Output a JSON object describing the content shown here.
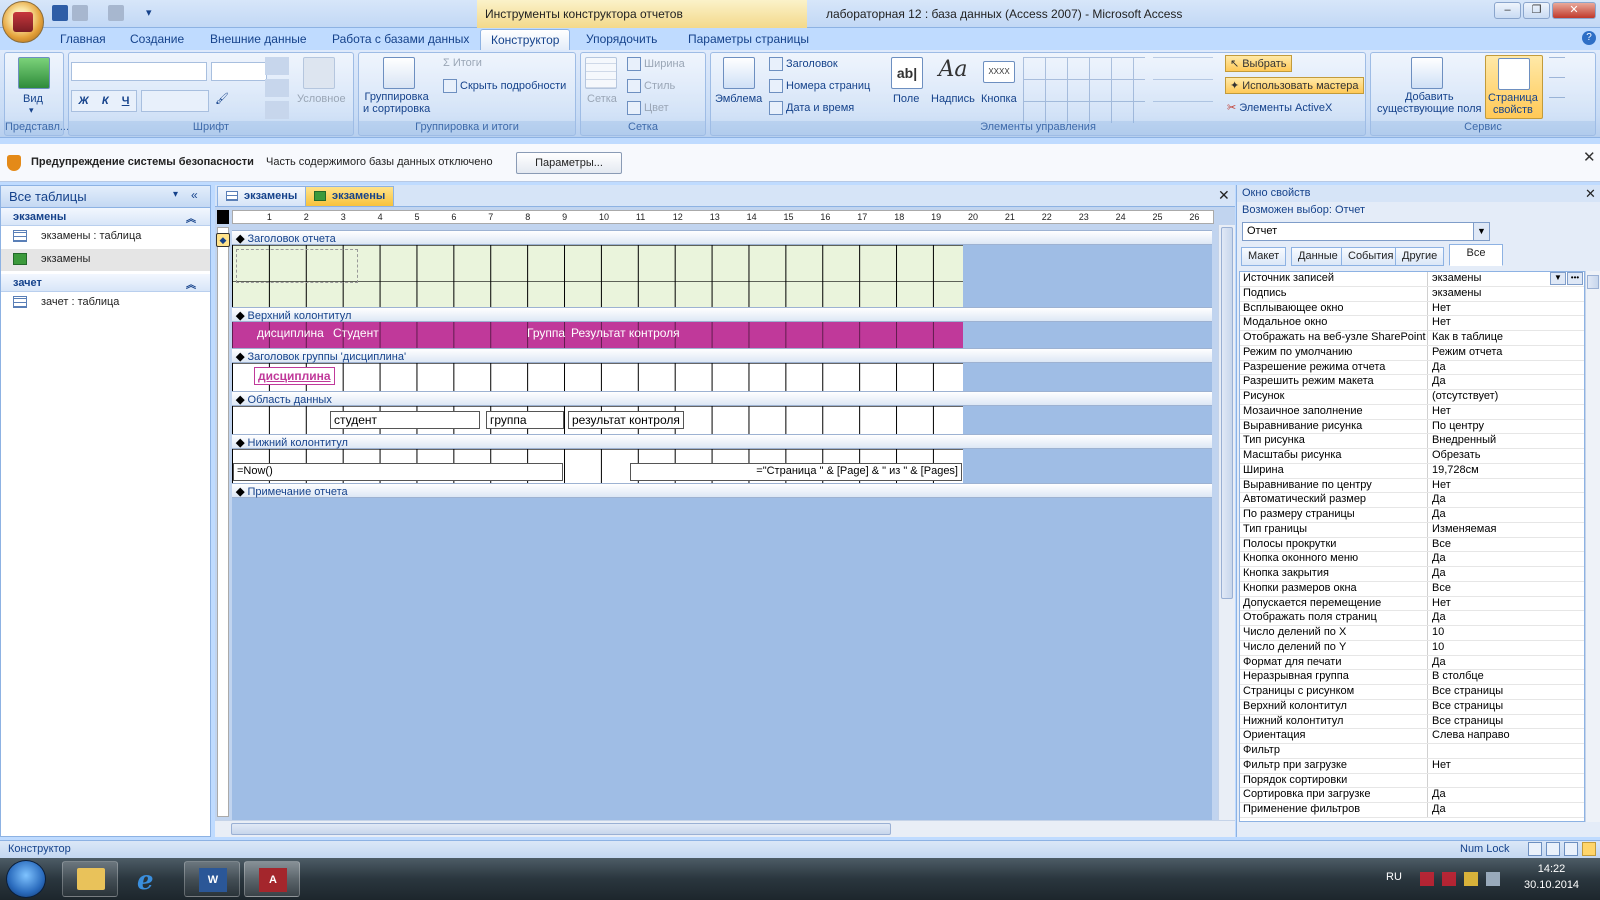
{
  "window": {
    "contextual_title": "Инструменты конструктора отчетов",
    "title": "лабораторная 12 : база данных (Access 2007) - Microsoft Access"
  },
  "ribbon_tabs": [
    "Главная",
    "Создание",
    "Внешние данные",
    "Работа с базами данных",
    "Конструктор",
    "Упорядочить",
    "Параметры страницы"
  ],
  "active_tab_index": 4,
  "ribbon": {
    "views": {
      "label": "Представл...",
      "view_button": "Вид"
    },
    "font": {
      "label": "Шрифт",
      "conditional": "Условное",
      "bold": "Ж",
      "italic": "К",
      "underline": "Ч"
    },
    "grouping": {
      "label": "Группировка и итоги",
      "group_sort": "Группировка\nи сортировка",
      "totals": "Итоги",
      "hide_details": "Скрыть подробности"
    },
    "gridlines": {
      "label": "Сетка",
      "grid": "Сетка",
      "width": "Ширина",
      "style": "Стиль",
      "color": "Цвет"
    },
    "controls": {
      "label": "Элементы управления",
      "logo": "Эмблема",
      "title": "Заголовок",
      "page_numbers": "Номера страниц",
      "date_time": "Дата и время",
      "field": "Поле",
      "label_ctrl": "Надпись",
      "button": "Кнопка",
      "select": "Выбрать",
      "use_wizards": "Использовать мастера",
      "activex": "Элементы ActiveX"
    },
    "tools": {
      "label": "Сервис",
      "add_fields": "Добавить\nсуществующие поля",
      "property_sheet": "Страница\nсвойств"
    }
  },
  "security_bar": {
    "warning_bold": "Предупреждение системы безопасности",
    "warning_text": "Часть содержимого базы данных отключено",
    "options_button": "Параметры..."
  },
  "nav": {
    "header": "Все таблицы",
    "groups": [
      {
        "name": "экзамены",
        "items": [
          {
            "label": "экзамены : таблица",
            "type": "table"
          },
          {
            "label": "экзамены",
            "type": "report",
            "selected": true
          }
        ]
      },
      {
        "name": "зачет",
        "items": [
          {
            "label": "зачет : таблица",
            "type": "table"
          }
        ]
      }
    ]
  },
  "document_tabs": [
    "экзамены",
    "экзамены"
  ],
  "active_doc_tab": 1,
  "report": {
    "ruler_numbers": [
      "1",
      "2",
      "3",
      "4",
      "5",
      "6",
      "7",
      "8",
      "9",
      "10",
      "11",
      "12",
      "13",
      "14",
      "15",
      "16",
      "17",
      "18",
      "19",
      "20",
      "21",
      "22",
      "23",
      "24",
      "25",
      "26"
    ],
    "sections": {
      "report_header": "Заголовок отчета",
      "page_header": "Верхний колонтитул",
      "group_header": "Заголовок группы 'дисциплина'",
      "detail": "Область данных",
      "page_footer": "Нижний колонтитул",
      "report_footer": "Примечание отчета"
    },
    "page_header_labels": [
      "дисциплина",
      "Студент",
      "Группа",
      "Результат контроля"
    ],
    "group_field": "дисциплина",
    "detail_fields": [
      "студент",
      "группа",
      "результат контроля"
    ],
    "footer_now": "=Now()",
    "footer_page": "=\"Страница \" & [Page] & \" из \" & [Pages]"
  },
  "properties": {
    "title": "Окно свойств",
    "selection_label": "Возможен выбор:",
    "selection_value": "Отчет",
    "object": "Отчет",
    "tabs": [
      "Макет",
      "Данные",
      "События",
      "Другие",
      "Все"
    ],
    "active_tab": 4,
    "rows": [
      [
        "Источник записей",
        "экзамены"
      ],
      [
        "Подпись",
        "экзамены"
      ],
      [
        "Всплывающее окно",
        "Нет"
      ],
      [
        "Модальное окно",
        "Нет"
      ],
      [
        "Отображать на веб-узле SharePoint",
        "Как в таблице"
      ],
      [
        "Режим по умолчанию",
        "Режим отчета"
      ],
      [
        "Разрешение режима отчета",
        "Да"
      ],
      [
        "Разрешить режим макета",
        "Да"
      ],
      [
        "Рисунок",
        "(отсутствует)"
      ],
      [
        "Мозаичное заполнение",
        "Нет"
      ],
      [
        "Выравнивание рисунка",
        "По центру"
      ],
      [
        "Тип рисунка",
        "Внедренный"
      ],
      [
        "Масштабы рисунка",
        "Обрезать"
      ],
      [
        "Ширина",
        "19,728см"
      ],
      [
        "Выравнивание по центру",
        "Нет"
      ],
      [
        "Автоматический размер",
        "Да"
      ],
      [
        "По размеру страницы",
        "Да"
      ],
      [
        "Тип границы",
        "Изменяемая"
      ],
      [
        "Полосы прокрутки",
        "Все"
      ],
      [
        "Кнопка оконного меню",
        "Да"
      ],
      [
        "Кнопка закрытия",
        "Да"
      ],
      [
        "Кнопки размеров окна",
        "Все"
      ],
      [
        "Допускается перемещение",
        "Нет"
      ],
      [
        "Отображать поля страниц",
        "Да"
      ],
      [
        "Число делений по X",
        "10"
      ],
      [
        "Число делений по Y",
        "10"
      ],
      [
        "Формат для печати",
        "Да"
      ],
      [
        "Неразрывная группа",
        "В столбце"
      ],
      [
        "Страницы с рисунком",
        "Все страницы"
      ],
      [
        "Верхний колонтитул",
        "Все страницы"
      ],
      [
        "Нижний колонтитул",
        "Все страницы"
      ],
      [
        "Ориентация",
        "Слева направо"
      ],
      [
        "Фильтр",
        ""
      ],
      [
        "Фильтр при загрузке",
        "Нет"
      ],
      [
        "Порядок сортировки",
        ""
      ],
      [
        "Сортировка при загрузке",
        "Да"
      ],
      [
        "Применение фильтров",
        "Да"
      ]
    ]
  },
  "status": {
    "mode": "Конструктор",
    "numlock": "Num Lock"
  },
  "taskbar": {
    "lang": "RU",
    "time": "14:22",
    "date": "30.10.2014"
  },
  "colors": {
    "page_header_band": "#c0399a",
    "grid_fill": "#eaf4dc",
    "canvas_bg": "#9fbde5"
  }
}
